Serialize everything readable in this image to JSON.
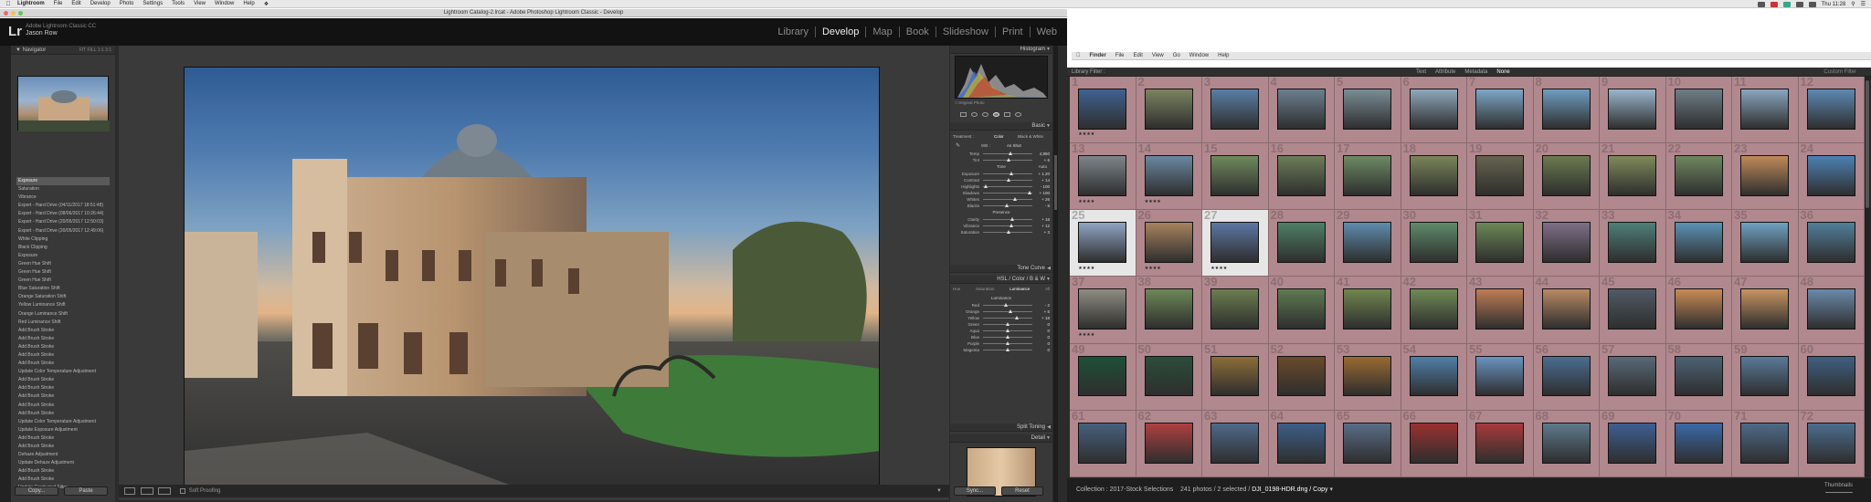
{
  "menubar": {
    "app": "Lightroom",
    "items": [
      "File",
      "Edit",
      "Develop",
      "Photo",
      "Settings",
      "Tools",
      "View",
      "Window",
      "Help"
    ],
    "clock": "Thu 11:28"
  },
  "window": {
    "title": "Lightroom Catalog-2.lrcat - Adobe Photoshop Lightroom Classic - Develop"
  },
  "lightroom": {
    "logo": "Lr",
    "version": "Adobe Lightroom Classic CC",
    "user": "Jason Row",
    "modules": [
      "Library",
      "Develop",
      "Map",
      "Book",
      "Slideshow",
      "Print",
      "Web"
    ],
    "active_module": "Develop"
  },
  "left_panel": {
    "navigator_label": "Navigator",
    "zoom_options": "FIT  FILL  1:1  3:1",
    "history": [
      {
        "label": "Exposure",
        "value": ""
      },
      {
        "label": "Saturation",
        "value": ""
      },
      {
        "label": "Vibrance",
        "value": ""
      },
      {
        "label": "Export - Hard Drive (04/11/2017 18:51:48)",
        "value": ""
      },
      {
        "label": "Export - Hard Drive (08/06/2017 10:26:44)",
        "value": ""
      },
      {
        "label": "Export - Hard Drive (20/05/2017 12:50:03)",
        "value": ""
      },
      {
        "label": "Export - Hard Drive (20/05/2017 12:49:06)",
        "value": ""
      },
      {
        "label": "White Clipping",
        "value": ""
      },
      {
        "label": "Black Clipping",
        "value": ""
      },
      {
        "label": "Exposure",
        "value": ""
      },
      {
        "label": "Green Hue Shift",
        "value": ""
      },
      {
        "label": "Green Hue Shift",
        "value": ""
      },
      {
        "label": "Green Hue Shift",
        "value": ""
      },
      {
        "label": "Blue Saturation Shift",
        "value": ""
      },
      {
        "label": "Orange Saturation Shift",
        "value": ""
      },
      {
        "label": "Yellow Luminance Shift",
        "value": ""
      },
      {
        "label": "Orange Luminance Shift",
        "value": ""
      },
      {
        "label": "Red Luminance Shift",
        "value": ""
      },
      {
        "label": "Add Brush Stroke",
        "value": ""
      },
      {
        "label": "Add Brush Stroke",
        "value": ""
      },
      {
        "label": "Add Brush Stroke",
        "value": ""
      },
      {
        "label": "Add Brush Stroke",
        "value": ""
      },
      {
        "label": "Add Brush Stroke",
        "value": ""
      },
      {
        "label": "Update Color Temperature Adjustment",
        "value": ""
      },
      {
        "label": "Add Brush Stroke",
        "value": ""
      },
      {
        "label": "Add Brush Stroke",
        "value": ""
      },
      {
        "label": "Add Brush Stroke",
        "value": ""
      },
      {
        "label": "Add Brush Stroke",
        "value": ""
      },
      {
        "label": "Add Brush Stroke",
        "value": ""
      },
      {
        "label": "Update Color Temperature Adjustment",
        "value": ""
      },
      {
        "label": "Update Exposure Adjustment",
        "value": ""
      },
      {
        "label": "Add Brush Stroke",
        "value": ""
      },
      {
        "label": "Add Brush Stroke",
        "value": ""
      },
      {
        "label": "Dehaze Adjustment",
        "value": ""
      },
      {
        "label": "Update Dehaze Adjustment",
        "value": ""
      },
      {
        "label": "Add Brush Stroke",
        "value": ""
      },
      {
        "label": "Add Brush Stroke",
        "value": ""
      },
      {
        "label": "Update Graduated Filter",
        "value": ""
      },
      {
        "label": "Update Color Temperature Adjustment",
        "value": ""
      },
      {
        "label": "Update Highlights Adjustment",
        "value": ""
      },
      {
        "label": "Update Shadows Adjustment",
        "value": ""
      }
    ],
    "copy_label": "Copy...",
    "paste_label": "Paste"
  },
  "center": {
    "toolbar_label": "Soft Proofing"
  },
  "right_panel": {
    "histogram_label": "Histogram",
    "original_photo_label": "Original Photo",
    "basic_label": "Basic",
    "treatment_label": "Treatment :",
    "treatment_color": "Color",
    "treatment_bw": "Black & White",
    "wb_label": "WB :",
    "wb_value": "As Shot",
    "tone_label": "Tone",
    "tone_auto": "Auto",
    "presence_label": "Presence",
    "basic_sliders": [
      {
        "label": "Temp",
        "value": 0.55,
        "text": "4,850"
      },
      {
        "label": "Tint",
        "value": 0.52,
        "text": "+ 6"
      },
      {
        "label": "Exposure",
        "value": 0.57,
        "text": "+ 1.20"
      },
      {
        "label": "Contrast",
        "value": 0.52,
        "text": "+ 14"
      },
      {
        "label": "Highlights",
        "value": 0.05,
        "text": "- 100"
      },
      {
        "label": "Shadows",
        "value": 0.95,
        "text": "+ 100"
      },
      {
        "label": "Whites",
        "value": 0.64,
        "text": "+ 26"
      },
      {
        "label": "Blacks",
        "value": 0.48,
        "text": "- 8"
      },
      {
        "label": "Clarity",
        "value": 0.6,
        "text": "+ 18"
      },
      {
        "label": "Vibrance",
        "value": 0.57,
        "text": "+ 12"
      },
      {
        "label": "Saturation",
        "value": 0.52,
        "text": "+ 3"
      }
    ],
    "tone_curve_label": "Tone Curve",
    "hsl_label": "HSL / Color / B & W",
    "hsl_tabs": [
      "Hue",
      "Saturation",
      "Luminance",
      "All"
    ],
    "hsl_section": "Luminance",
    "hsl_sliders": [
      {
        "label": "Red",
        "value": 0.47,
        "text": "- 2"
      },
      {
        "label": "Orange",
        "value": 0.55,
        "text": "+ 5"
      },
      {
        "label": "Yellow",
        "value": 0.68,
        "text": "+ 18"
      },
      {
        "label": "Green",
        "value": 0.5,
        "text": "0"
      },
      {
        "label": "Aqua",
        "value": 0.5,
        "text": "0"
      },
      {
        "label": "Blue",
        "value": 0.5,
        "text": "0"
      },
      {
        "label": "Purple",
        "value": 0.5,
        "text": "0"
      },
      {
        "label": "Magenta",
        "value": 0.5,
        "text": "0"
      }
    ],
    "split_toning_label": "Split Toning",
    "detail_label": "Detail",
    "sync_label": "Sync...",
    "reset_label": "Reset"
  },
  "finder": {
    "app": "Finder",
    "items": [
      "File",
      "Edit",
      "View",
      "Go",
      "Window",
      "Help"
    ]
  },
  "library": {
    "filter_label": "Library Filter :",
    "filter_tabs": [
      "Text",
      "Attribute",
      "Metadata",
      "None"
    ],
    "active_filter": "None",
    "custom_filter": "Custom Filter",
    "collection": "Collection : 2017-Stock Selections",
    "count": "241 photos / 2 selected /",
    "selected_file": "DJI_0198-HDR.dng / Copy",
    "thumbnails_label": "Thumbnails"
  },
  "grid": {
    "highlighted": [
      25,
      27
    ],
    "starred": [
      1,
      13,
      14,
      25,
      26,
      27,
      37
    ],
    "thumb_colors": [
      "#3f6291",
      "#7c8460",
      "#5a7fa6",
      "#6c7f8f",
      "#7a8d97",
      "#8fa8bb",
      "#7da7c7",
      "#6f9dc1",
      "#9ab6cc",
      "#6e7e87",
      "#8aa6be",
      "#5d89b3",
      "#7d858a",
      "#6a88a2",
      "#6f8a5d",
      "#6d7d58",
      "#6d8a64",
      "#7a8559",
      "#66644f",
      "#6b7a4f",
      "#7f8a5a",
      "#6f8760",
      "#c08a5a",
      "#4c81b3",
      "#8fa5c4",
      "#a7835e",
      "#5d77a4",
      "#4f7f66",
      "#5e8cae",
      "#5f8b6a",
      "#6d8856",
      "#7f6f88",
      "#4e7f78",
      "#5a92b4",
      "#6fa2c2",
      "#527f9a",
      "#8e8d82",
      "#6d8857",
      "#6b7e4f",
      "#5f7a52",
      "#71864f",
      "#6f8a55",
      "#c07d55",
      "#b88a64",
      "#505a66",
      "#c98b55",
      "#c79462",
      "#6b8aaa",
      "#1e5037",
      "#2b4d3a",
      "#8d6d39",
      "#6a4a2a",
      "#9a6a31",
      "#507fa8",
      "#6a93c0",
      "#4a6e92",
      "#596977",
      "#4d6275",
      "#5a7a98",
      "#3f5f80",
      "#47607d",
      "#b04040",
      "#4f6a8a",
      "#3d5f88",
      "#5a6e86",
      "#9a3030",
      "#a83a3a",
      "#5e7a8c",
      "#3e5f93",
      "#3b6aa7",
      "#4f6a88",
      "#4c6e8e"
    ]
  }
}
